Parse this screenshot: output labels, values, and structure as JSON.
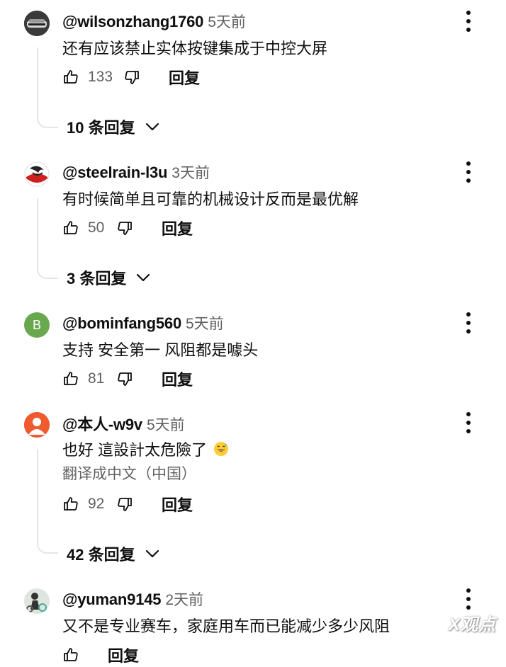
{
  "comments": [
    {
      "handle": "@wilsonzhang1760",
      "time": "5天前",
      "text": "还有应该禁止实体按键集成于中控大屏",
      "likes": "133",
      "reply_label": "回复",
      "replies_label": "10 条回复"
    },
    {
      "handle": "@steelrain-l3u",
      "time": "3天前",
      "text": "有时候简单且可靠的机械设计反而是最优解",
      "likes": "50",
      "reply_label": "回复",
      "replies_label": "3 条回复"
    },
    {
      "avatar_letter": "B",
      "handle": "@bominfang560",
      "time": "5天前",
      "text": "支持 安全第一 风阻都是噱头",
      "likes": "81",
      "reply_label": "回复"
    },
    {
      "handle": "@本人-w9v",
      "time": "5天前",
      "text": "也好  這設計太危險了",
      "translate_label": "翻译成中文（中国）",
      "likes": "92",
      "reply_label": "回复",
      "replies_label": "42 条回复"
    },
    {
      "handle": "@yuman9145",
      "time": "2天前",
      "text": "又不是专业赛车，家庭用车而已能减少多少风阻",
      "reply_label": "回复"
    }
  ],
  "watermark": "X观点",
  "icons": {
    "like": "thumb-up-icon",
    "dislike": "thumb-down-icon",
    "expand": "chevron-down-icon",
    "menu": "more-vert-icon",
    "emoji": "grinning-sweat-emoji"
  }
}
